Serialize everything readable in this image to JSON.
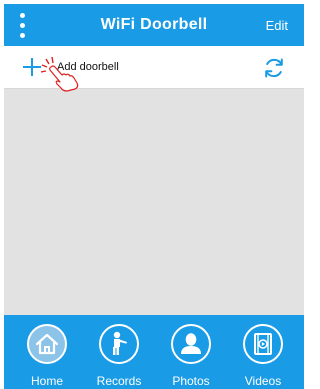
{
  "header": {
    "title": "WiFi Doorbell",
    "edit_label": "Edit",
    "menu_icon": "more-vertical-icon"
  },
  "toolbar": {
    "add_label": "Add doorbell",
    "add_icon": "plus-icon",
    "refresh_icon": "refresh-icon",
    "hint_icon": "tap-hand-icon"
  },
  "tabs": [
    {
      "label": "Home",
      "icon": "home-icon",
      "active": true
    },
    {
      "label": "Records",
      "icon": "person-pointing-icon",
      "active": false
    },
    {
      "label": "Photos",
      "icon": "person-silhouette-icon",
      "active": false
    },
    {
      "label": "Videos",
      "icon": "film-play-icon",
      "active": false
    }
  ],
  "colors": {
    "accent": "#1a9be6",
    "content_bg": "#e2e2e2",
    "active_tab_fill": "#8cc3e8",
    "hint_red": "#e02020"
  }
}
